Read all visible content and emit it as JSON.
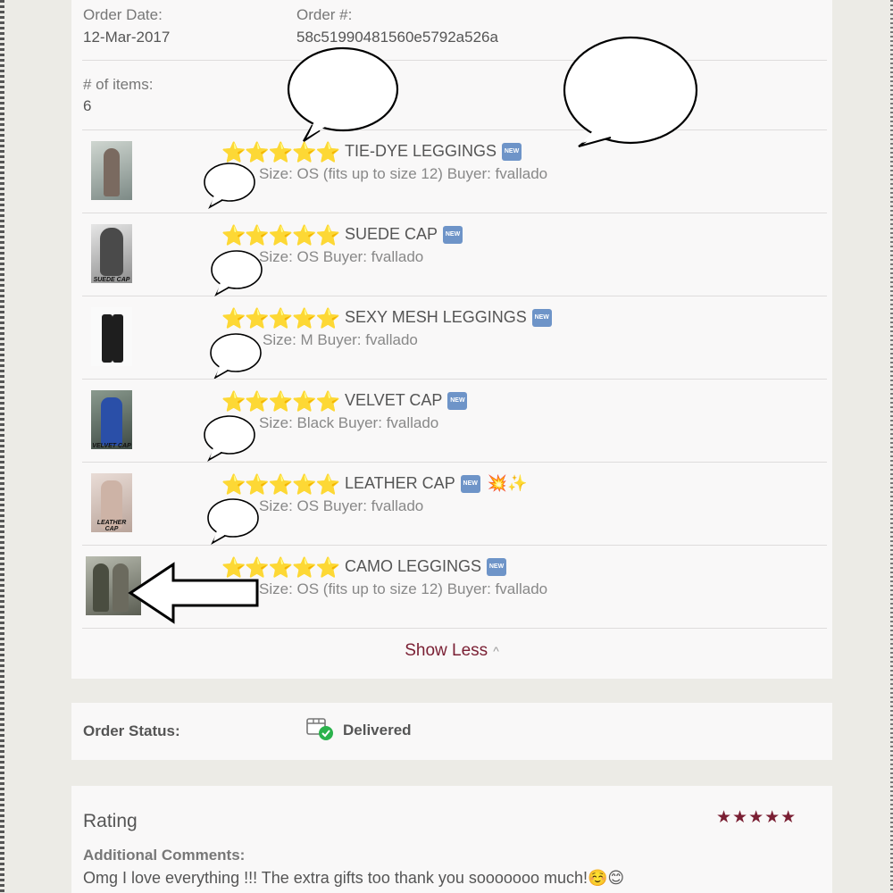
{
  "order": {
    "date_label": "Order Date:",
    "date_value": "12-Mar-2017",
    "number_label": "Order #:",
    "number_value": "58c51990481560e5792a526a",
    "items_label": "# of items:",
    "items_value": "6"
  },
  "items": [
    {
      "stars": "⭐⭐⭐⭐⭐",
      "title": "TIE-DYE LEGGINGS",
      "badge": "NEW",
      "extra": "",
      "meta": "Size: OS (fits up to size 12)  Buyer: fvallado",
      "thumb_caption": ""
    },
    {
      "stars": "⭐⭐⭐⭐⭐",
      "title": "SUEDE CAP",
      "badge": "NEW",
      "extra": "",
      "meta": "Size: OS  Buyer: fvallado",
      "thumb_caption": "SUEDE CAP"
    },
    {
      "stars": "⭐⭐⭐⭐⭐",
      "title": "SEXY MESH LEGGINGS",
      "badge": "NEW",
      "extra": "",
      "meta": "Size: M  Buyer: fvallado",
      "thumb_caption": ""
    },
    {
      "stars": "⭐⭐⭐⭐⭐",
      "title": "VELVET CAP",
      "badge": "NEW",
      "extra": "",
      "meta": "Size: Black  Buyer: fvallado",
      "thumb_caption": "VELVET CAP"
    },
    {
      "stars": "⭐⭐⭐⭐⭐",
      "title": "LEATHER CAP",
      "badge": "NEW",
      "extra": "💥✨",
      "meta": "Size: OS  Buyer: fvallado",
      "thumb_caption": "LEATHER CAP"
    },
    {
      "stars": "⭐⭐⭐⭐⭐",
      "title": "CAMO LEGGINGS",
      "badge": "NEW",
      "extra": "",
      "meta": "Size: OS (fits up to size 12)  Buyer: fvallado",
      "thumb_caption": ""
    }
  ],
  "show_less": {
    "label": "Show Less"
  },
  "status": {
    "label": "Order Status:",
    "value": "Delivered"
  },
  "rating": {
    "title": "Rating",
    "stars": "★★★★★",
    "comments_label": "Additional Comments:",
    "comments_text": "Omg I love everything !!! The extra gifts too thank you sooooooo much!☺️😊"
  },
  "colors": {
    "accent": "#7a1f33",
    "star": "#f7c51c",
    "new_badge": "#6e94c8",
    "check": "#2bb24c"
  }
}
